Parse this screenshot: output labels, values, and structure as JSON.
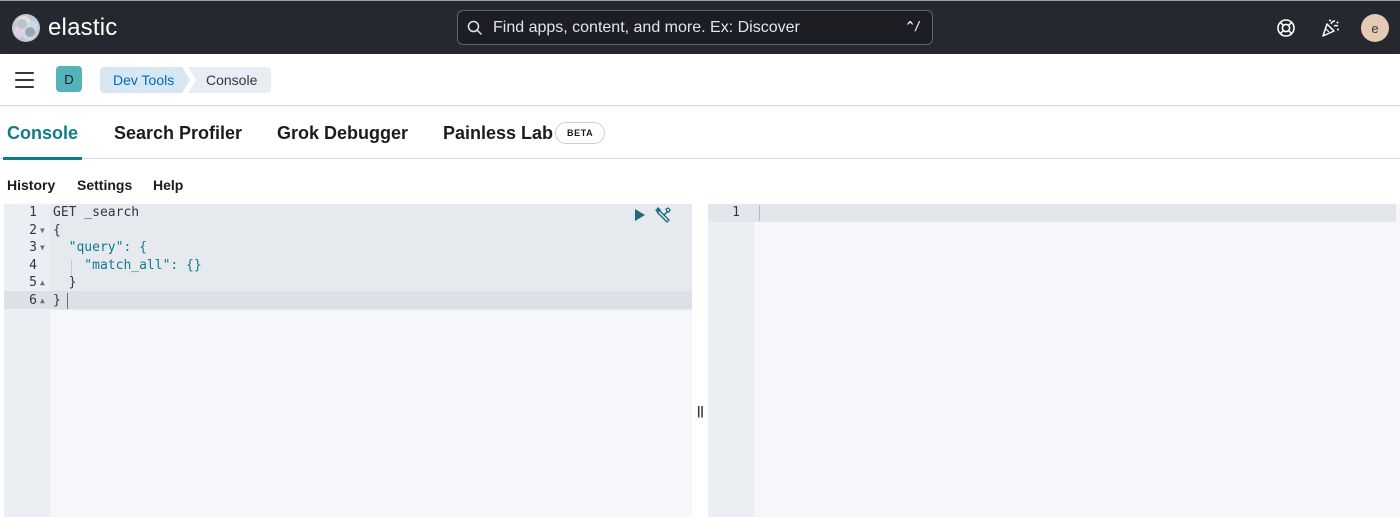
{
  "header": {
    "logo_text": "elastic",
    "search": {
      "placeholder": "Find apps, content, and more. Ex: Discover",
      "shortcut": "^/"
    },
    "avatar_initial": "e",
    "icons": [
      "help-icon",
      "newsfeed-icon"
    ]
  },
  "breadcrumbs": {
    "space_initial": "D",
    "items": [
      "Dev Tools",
      "Console"
    ]
  },
  "tabs": [
    {
      "label": "Console",
      "active": true
    },
    {
      "label": "Search Profiler",
      "active": false
    },
    {
      "label": "Grok Debugger",
      "active": false
    },
    {
      "label": "Painless Lab",
      "active": false,
      "badge": "BETA"
    }
  ],
  "toolbar": {
    "items": [
      "History",
      "Settings",
      "Help"
    ]
  },
  "editor": {
    "lines": [
      {
        "number": "1",
        "code": "GET _search"
      },
      {
        "number": "2",
        "code": "{"
      },
      {
        "number": "3",
        "code": "  \"query\": {"
      },
      {
        "number": "4",
        "code": "    \"match_all\": {}"
      },
      {
        "number": "5",
        "code": "  }"
      },
      {
        "number": "6",
        "code": "}"
      }
    ],
    "icons": [
      "run-icon",
      "wrench-icon"
    ]
  },
  "output": {
    "lines": [
      {
        "number": "1",
        "code": ""
      }
    ]
  },
  "colors": {
    "header_bg": "#25282f",
    "accent": "#0f7b8d",
    "space_badge": "#54b3ba"
  }
}
